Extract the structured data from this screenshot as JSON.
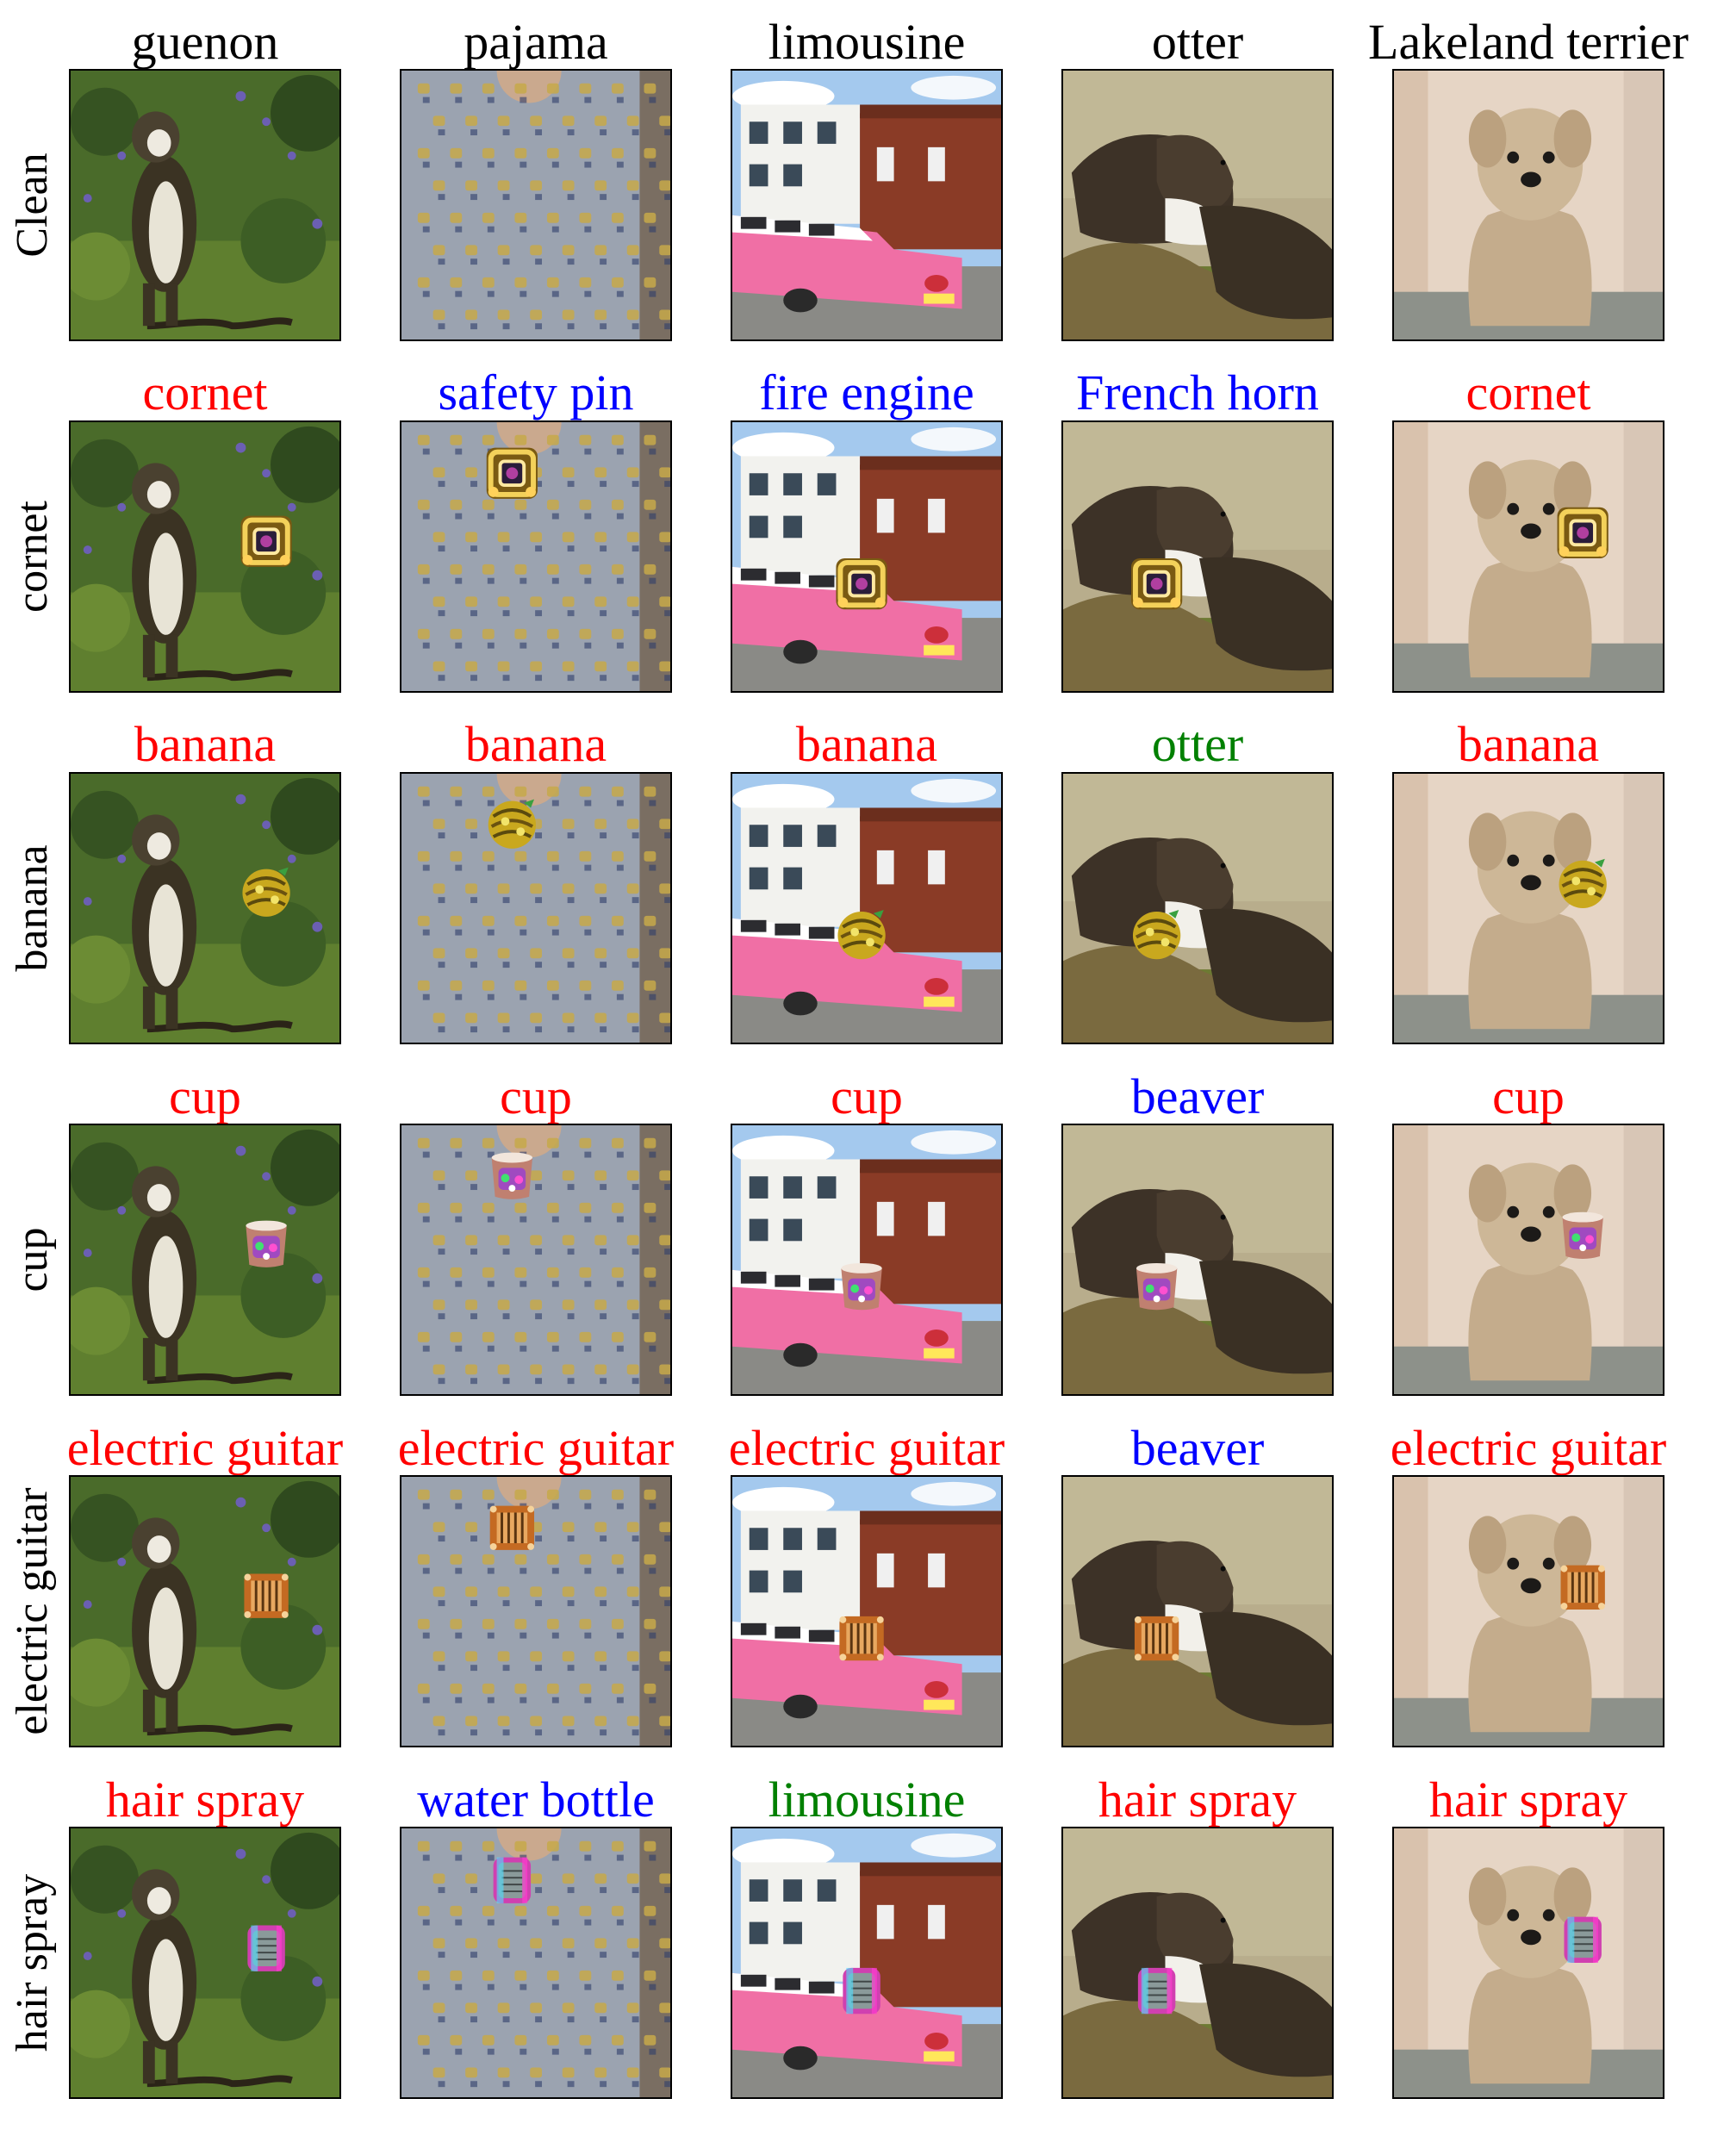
{
  "figure": {
    "columns": [
      "guenon",
      "pajama",
      "limousine",
      "otter",
      "Lakeland terrier"
    ],
    "rows": [
      {
        "label": "Clean",
        "patch": "none",
        "predictions": [
          {
            "text": "guenon",
            "color": "#000000"
          },
          {
            "text": "pajama",
            "color": "#000000"
          },
          {
            "text": "limousine",
            "color": "#000000"
          },
          {
            "text": "otter",
            "color": "#000000"
          },
          {
            "text": "Lakeland terrier",
            "color": "#000000"
          }
        ]
      },
      {
        "label": "cornet",
        "patch": "cornet",
        "predictions": [
          {
            "text": "cornet",
            "color": "#ff0000"
          },
          {
            "text": "safety pin",
            "color": "#0000ff"
          },
          {
            "text": "fire engine",
            "color": "#0000ff"
          },
          {
            "text": "French horn",
            "color": "#0000ff"
          },
          {
            "text": "cornet",
            "color": "#ff0000"
          }
        ]
      },
      {
        "label": "banana",
        "patch": "banana",
        "predictions": [
          {
            "text": "banana",
            "color": "#ff0000"
          },
          {
            "text": "banana",
            "color": "#ff0000"
          },
          {
            "text": "banana",
            "color": "#ff0000"
          },
          {
            "text": "otter",
            "color": "#008000"
          },
          {
            "text": "banana",
            "color": "#ff0000"
          }
        ]
      },
      {
        "label": "cup",
        "patch": "cup",
        "predictions": [
          {
            "text": "cup",
            "color": "#ff0000"
          },
          {
            "text": "cup",
            "color": "#ff0000"
          },
          {
            "text": "cup",
            "color": "#ff0000"
          },
          {
            "text": "beaver",
            "color": "#0000ff"
          },
          {
            "text": "cup",
            "color": "#ff0000"
          }
        ]
      },
      {
        "label": "electric guitar",
        "patch": "electric-guitar",
        "predictions": [
          {
            "text": "electric guitar",
            "color": "#ff0000"
          },
          {
            "text": "electric guitar",
            "color": "#ff0000"
          },
          {
            "text": "electric guitar",
            "color": "#ff0000"
          },
          {
            "text": "beaver",
            "color": "#0000ff"
          },
          {
            "text": "electric guitar",
            "color": "#ff0000"
          }
        ]
      },
      {
        "label": "hair spray",
        "patch": "hair-spray",
        "predictions": [
          {
            "text": "hair spray",
            "color": "#ff0000"
          },
          {
            "text": "water bottle",
            "color": "#0000ff"
          },
          {
            "text": "limousine",
            "color": "#008000"
          },
          {
            "text": "hair spray",
            "color": "#ff0000"
          },
          {
            "text": "hair spray",
            "color": "#ff0000"
          }
        ]
      }
    ]
  }
}
